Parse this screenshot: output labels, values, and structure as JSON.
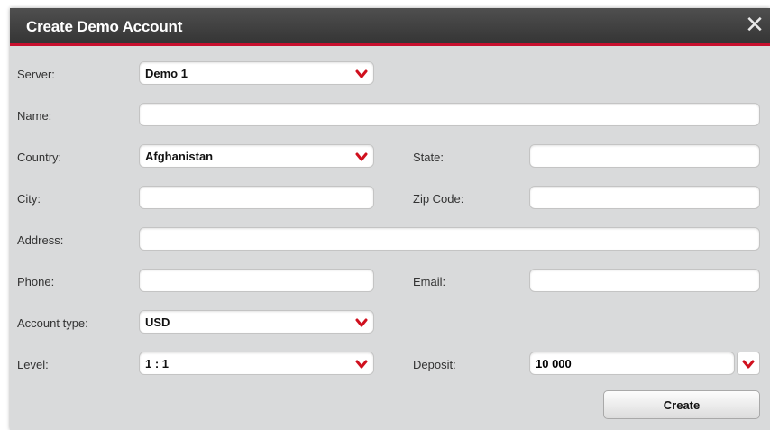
{
  "dialog": {
    "title": "Create Demo Account",
    "close_symbol": "✕"
  },
  "form": {
    "server": {
      "label": "Server:",
      "value": "Demo 1"
    },
    "name": {
      "label": "Name:",
      "value": ""
    },
    "country": {
      "label": "Country:",
      "value": "Afghanistan"
    },
    "state": {
      "label": "State:",
      "value": ""
    },
    "city": {
      "label": "City:",
      "value": ""
    },
    "zip": {
      "label": "Zip Code:",
      "value": ""
    },
    "address": {
      "label": "Address:",
      "value": ""
    },
    "phone": {
      "label": "Phone:",
      "value": ""
    },
    "email": {
      "label": "Email:",
      "value": ""
    },
    "account_type": {
      "label": "Account type:",
      "value": "USD"
    },
    "level": {
      "label": "Level:",
      "value": "1 : 1"
    },
    "deposit": {
      "label": "Deposit:",
      "value": "10 000"
    }
  },
  "actions": {
    "create_label": "Create"
  },
  "colors": {
    "accent": "#c8102e",
    "titlebar": "#3d3d3d",
    "panel": "#d9dadb"
  },
  "icons": {
    "close": "close-icon",
    "dropdown": "chevron-down-icon"
  }
}
